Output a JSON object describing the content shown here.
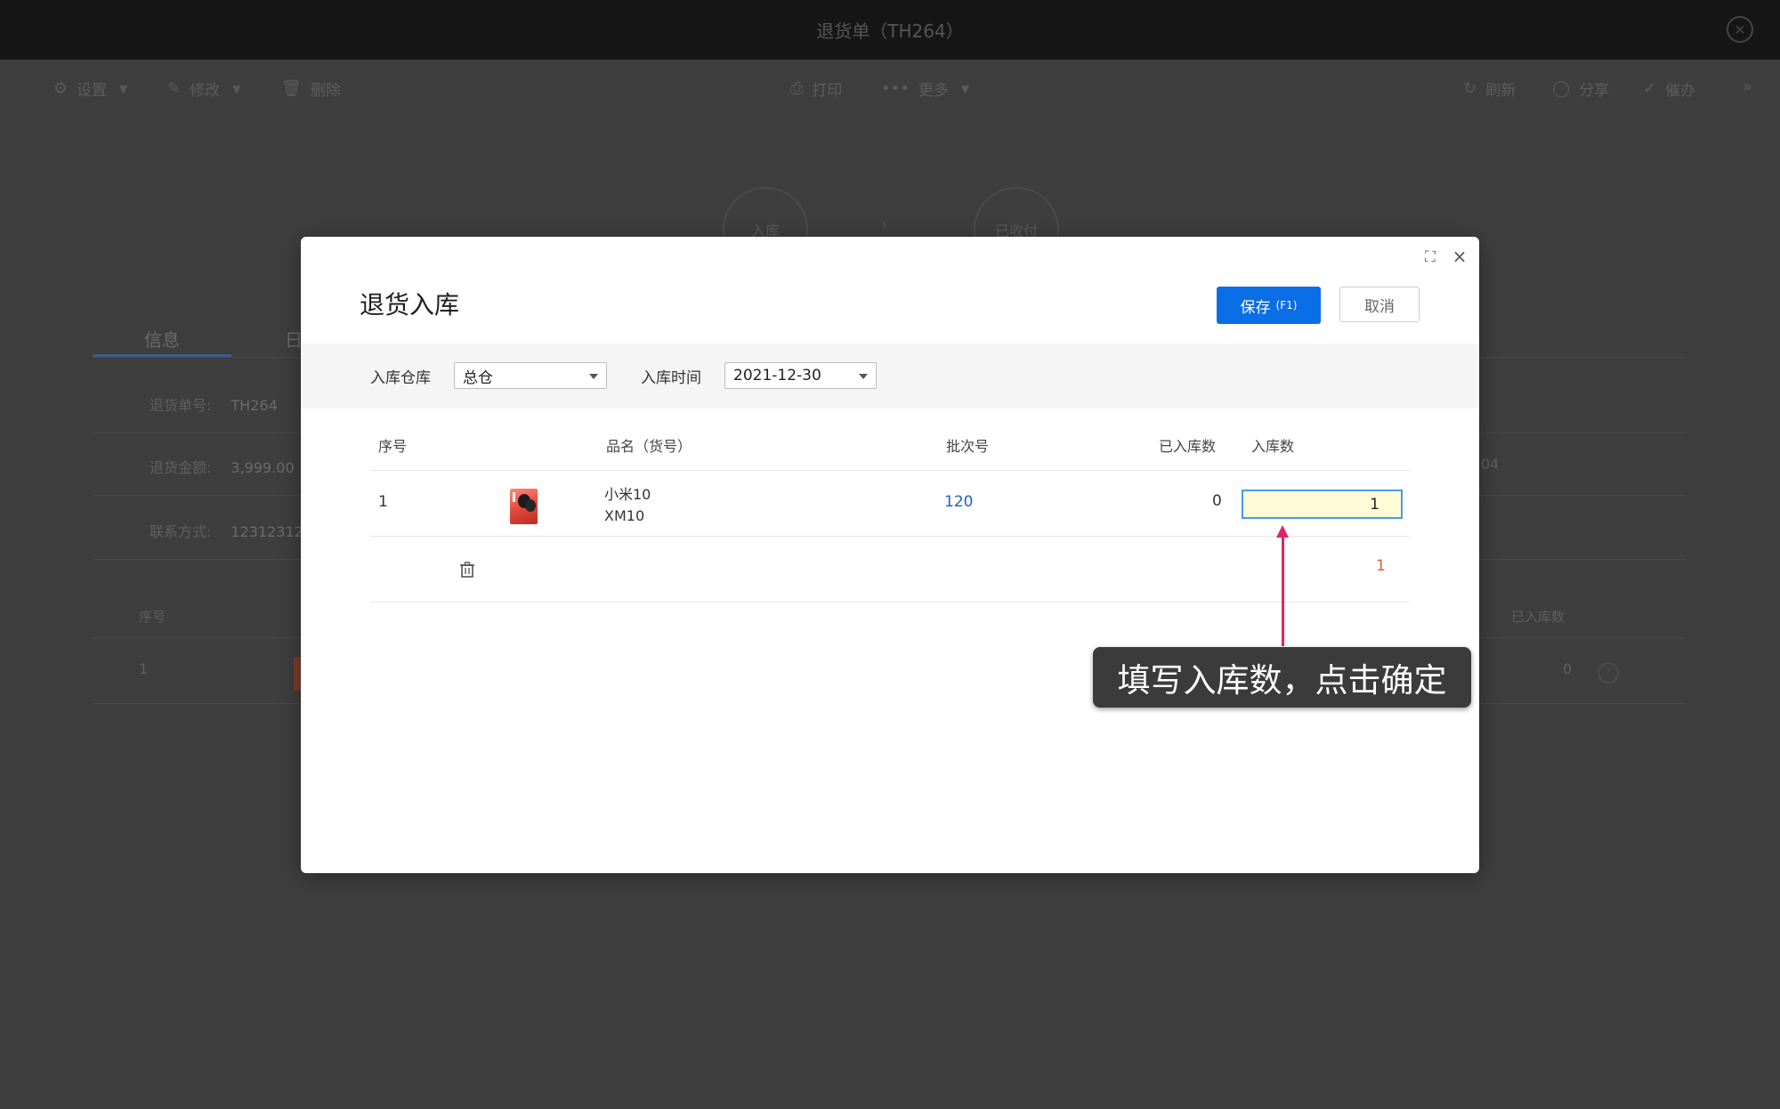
{
  "window": {
    "title": "退货单（TH264）"
  },
  "toolbar": {
    "settings": "设置",
    "edit": "修改",
    "delete": "删除",
    "print": "打印",
    "more": "更多",
    "refresh": "刷新",
    "share": "分享",
    "done": "催办"
  },
  "steps": [
    "入库",
    "已收付"
  ],
  "tabs": {
    "info": "信息",
    "log": "日"
  },
  "background_fields": {
    "return_no_label": "退货单号:",
    "return_no": "TH264",
    "return_amount_label": "退货金额:",
    "return_amount": "3,999.00",
    "contact_label": "联系方式:",
    "contact": "12312312",
    "right_value": "04"
  },
  "background_table": {
    "headers": [
      "序号",
      "已入库数"
    ],
    "row": {
      "index": "1",
      "stocked": "0"
    }
  },
  "modal": {
    "title": "退货入库",
    "save_label": "保存",
    "save_hotkey": "(F1)",
    "cancel_label": "取消",
    "warehouse_label": "入库仓库",
    "warehouse_value": "总仓",
    "date_label": "入库时间",
    "date_value": "2021-12-30",
    "table": {
      "headers": {
        "index": "序号",
        "name": "品名（货号）",
        "batch": "批次号",
        "stocked": "已入库数",
        "qty": "入库数"
      },
      "rows": [
        {
          "index": "1",
          "name": "小米10",
          "sku": "XM10",
          "batch": "120",
          "stocked": "0",
          "qty": "1"
        }
      ],
      "total_qty": "1"
    }
  },
  "annotation": {
    "text": "填写入库数，点击确定"
  },
  "colors": {
    "primary": "#0a6ee6",
    "callout_arrow": "#e0246a",
    "input_bg": "#fffbd7",
    "total_qty": "#e05a3c"
  }
}
